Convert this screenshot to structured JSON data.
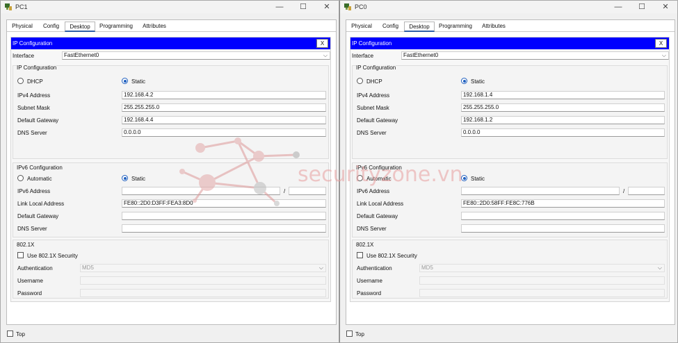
{
  "tab_labels": [
    "Physical",
    "Config",
    "Desktop",
    "Programming",
    "Attributes"
  ],
  "ip_config_bar_title": "IP Configuration",
  "close_label": "X",
  "labels": {
    "interface": "Interface",
    "ip_configuration": "IP Configuration",
    "dhcp": "DHCP",
    "static": "Static",
    "ipv4_address": "IPv4 Address",
    "subnet_mask": "Subnet Mask",
    "default_gateway": "Default Gateway",
    "dns_server": "DNS Server",
    "ipv6_configuration": "IPv6 Configuration",
    "automatic": "Automatic",
    "ipv6_address": "IPv6 Address",
    "link_local_address": "Link Local Address",
    "ipv6_slash": "/",
    "dot1x": "802.1X",
    "use_dot1x": "Use 802.1X Security",
    "authentication": "Authentication",
    "username": "Username",
    "password": "Password",
    "top": "Top"
  },
  "window_controls": {
    "minimize": "—",
    "maximize": "☐",
    "close": "✕"
  },
  "left": {
    "title": "PC1",
    "interface": "FastEthernet0",
    "ipv4_address": "192.168.4.2",
    "subnet_mask": "255.255.255.0",
    "default_gateway": "192.168.4.4",
    "dns_server": "0.0.0.0",
    "link_local": "FE80::2D0:D3FF:FEA3:8D0",
    "auth_method": "MD5"
  },
  "right": {
    "title": "PC0",
    "interface": "FastEthernet0",
    "ipv4_address": "192.168.1.4",
    "subnet_mask": "255.255.255.0",
    "default_gateway": "192.168.1.2",
    "dns_server": "0.0.0.0",
    "link_local": "FE80::2D0:58FF:FE8C:776B",
    "auth_method": "MD5"
  },
  "watermark_text": "securityzone.vn",
  "colors": {
    "ip_bar": "#0000ff",
    "radio_selected": "#1f5fbf",
    "watermark": "#e8a0a0"
  }
}
